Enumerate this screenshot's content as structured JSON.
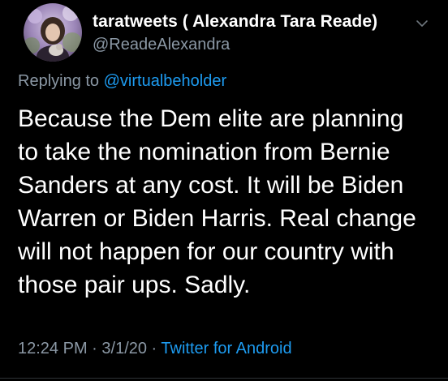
{
  "tweet": {
    "author": {
      "display_name": "taratweets ( Alexandra Tara Reade)",
      "handle": "@ReadeAlexandra",
      "avatar_icon": "profile-photo"
    },
    "menu_icon": "chevron-down-icon",
    "reply": {
      "prefix": "Replying to ",
      "mention": "@virtualbeholder"
    },
    "text": "Because the Dem elite are planning\nto take the nomination from Bernie\nSanders at any cost. It will be Biden\nWarren or Biden Harris. Real change\nwill not happen for our country with\nthose pair ups. Sadly.",
    "meta": {
      "time": "12:24 PM",
      "separator": " · ",
      "date": "3/1/20",
      "source": "Twitter for Android"
    },
    "colors": {
      "background": "#000000",
      "primary_text": "#ffffff",
      "secondary_text": "#8b98a5",
      "link": "#1d9bf0"
    }
  }
}
